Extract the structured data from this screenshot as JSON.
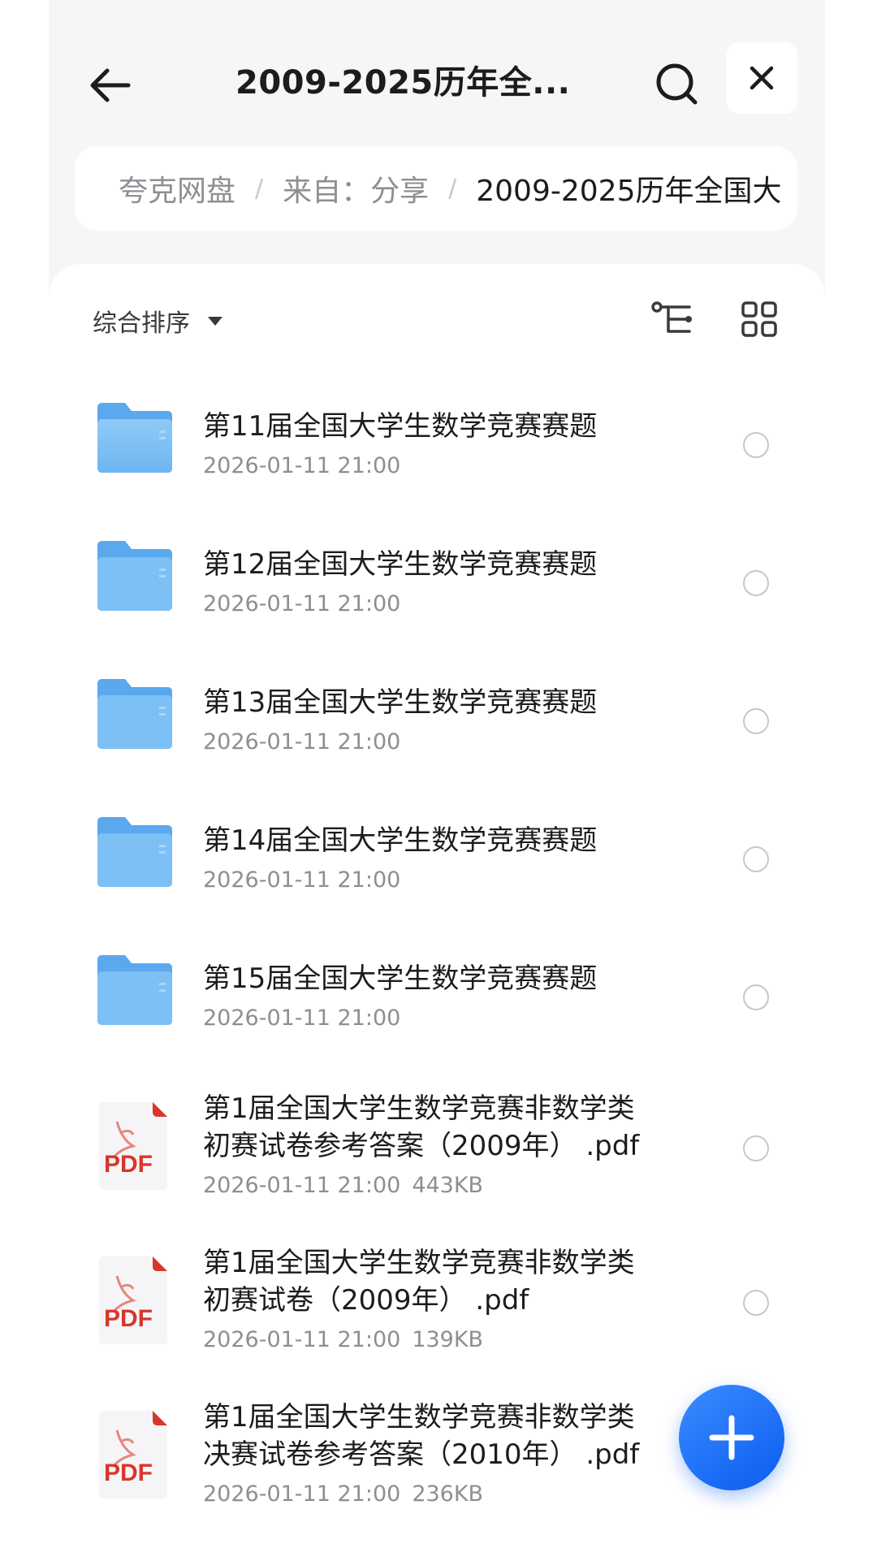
{
  "header": {
    "title": "2009-2025历年全...",
    "back_icon": "arrow-left-icon",
    "search_icon": "search-icon",
    "close_icon": "close-icon"
  },
  "breadcrumb": {
    "items": [
      "夸克网盘",
      "来自：分享",
      "2009-2025历年全国大"
    ],
    "separator": "/"
  },
  "toolbar": {
    "sort_label": "综合排序",
    "sort_icon": "caret-down-icon",
    "tree_icon": "tree-view-icon",
    "grid_icon": "grid-view-icon"
  },
  "files": [
    {
      "type": "folder",
      "name": "第11届全国大学生数学竞赛赛题",
      "date": "2026-01-11 21:00",
      "size": ""
    },
    {
      "type": "folder",
      "name": "第12届全国大学生数学竞赛赛题",
      "date": "2026-01-11 21:00",
      "size": ""
    },
    {
      "type": "folder",
      "name": "第13届全国大学生数学竞赛赛题",
      "date": "2026-01-11 21:00",
      "size": ""
    },
    {
      "type": "folder",
      "name": "第14届全国大学生数学竞赛赛题",
      "date": "2026-01-11 21:00",
      "size": ""
    },
    {
      "type": "folder",
      "name": "第15届全国大学生数学竞赛赛题",
      "date": "2026-01-11 21:00",
      "size": ""
    },
    {
      "type": "pdf",
      "name_line1": "第1届全国大学生数学竞赛非数学类",
      "name_line2": "初赛试卷参考答案（2009年） .pdf",
      "date": "2026-01-11 21:00",
      "size": "443KB"
    },
    {
      "type": "pdf",
      "name_line1": "第1届全国大学生数学竞赛非数学类",
      "name_line2": "初赛试卷（2009年） .pdf",
      "date": "2026-01-11 21:00",
      "size": "139KB"
    },
    {
      "type": "pdf",
      "name_line1": "第1届全国大学生数学竞赛非数学类",
      "name_line2": "决赛试卷参考答案（2010年） .pdf",
      "date": "2026-01-11 21:00",
      "size": "236KB"
    }
  ],
  "pdf_badge": "PDF",
  "fab": {
    "icon": "plus-icon"
  },
  "colors": {
    "accent": "#1a6ef5",
    "folder": "#7cc0f5",
    "pdf_red": "#d9362b"
  }
}
